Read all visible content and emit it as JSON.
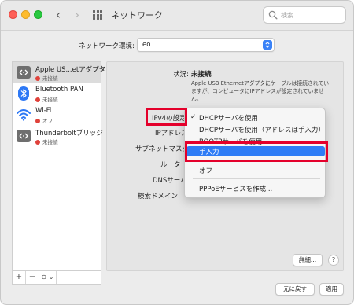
{
  "window": {
    "title": "ネットワーク",
    "search_placeholder": "検索"
  },
  "location": {
    "label": "ネットワーク環境:",
    "value": "eo"
  },
  "services": [
    {
      "name": "Apple US...etアダプタ",
      "status": "未接続",
      "status_color": "#e0413a",
      "icon": "ethernet-icon",
      "selected": true
    },
    {
      "name": "Bluetooth PAN",
      "status": "未接続",
      "status_color": "#e0413a",
      "icon": "bluetooth-icon"
    },
    {
      "name": "Wi-Fi",
      "status": "オフ",
      "status_color": "#e0413a",
      "icon": "wifi-icon"
    },
    {
      "name": "Thunderboltブリッジ",
      "status": "未接続",
      "status_color": "#e0413a",
      "icon": "thunderbolt-bridge-icon"
    }
  ],
  "sidebar_tools": {
    "add": "+",
    "remove": "−",
    "action": "⊙ ⌄"
  },
  "detail": {
    "status_label": "状況:",
    "status_value": "未接続",
    "status_description": "Apple USB Ethernetアダプタにケーブルは接続されていますが、コンピュータにIPアドレスが設定されていません。",
    "fields": {
      "ipv4": "IPv4の設定",
      "ip_address": "IPアドレス",
      "subnet": "サブネットマスク",
      "router": "ルーター",
      "dns": "DNSサーバ",
      "search_domain": "検索ドメイン"
    }
  },
  "menu": {
    "items": [
      {
        "label": "DHCPサーバを使用",
        "checked": true
      },
      {
        "label": "DHCPサーバを使用（アドレスは手入力）"
      },
      {
        "label": "BOOTPサーバを使用"
      },
      {
        "label": "手入力",
        "highlighted": true
      },
      {
        "label": "オフ"
      },
      {
        "label": "PPPoEサービスを作成..."
      }
    ],
    "check_mark": "✓"
  },
  "buttons": {
    "advanced": "詳細...",
    "help": "?",
    "revert": "元に戻す",
    "apply": "適用"
  },
  "colors": {
    "accent": "#2e7cf6",
    "highlight_box": "#e4002b"
  }
}
